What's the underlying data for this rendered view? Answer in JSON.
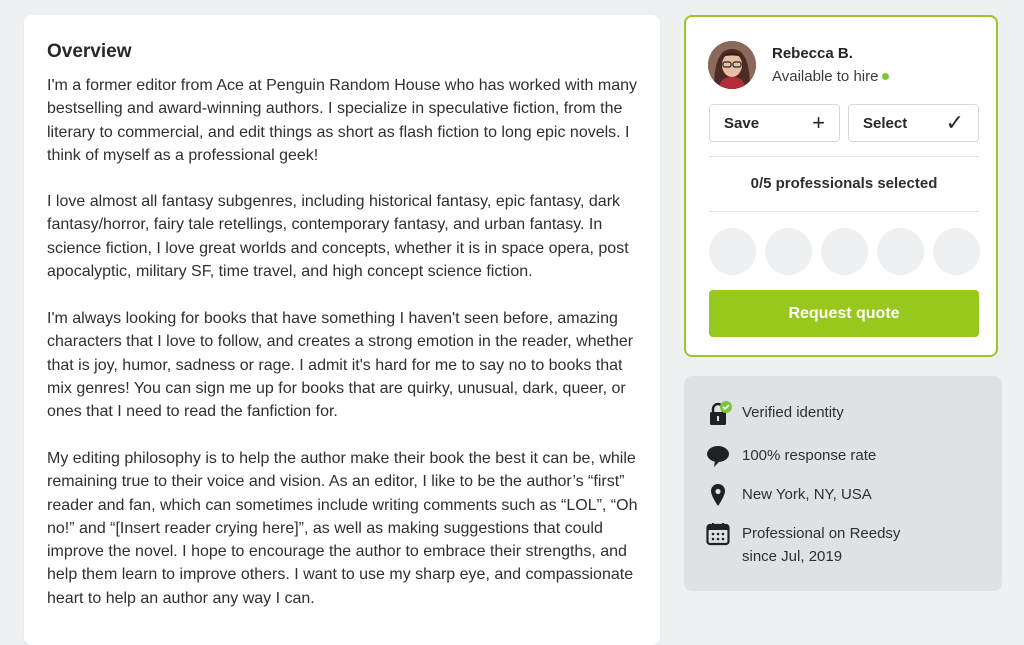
{
  "overview": {
    "title": "Overview",
    "paragraphs": [
      "I'm a former editor from Ace at Penguin Random House who has worked with many bestselling and award-winning authors. I specialize in speculative fiction, from the literary to commercial, and edit things as short as flash fiction to long epic novels. I think of myself as a professional geek!",
      "I love almost all fantasy subgenres, including historical fantasy, epic fantasy, dark fantasy/horror, fairy tale retellings, contemporary fantasy, and urban fantasy. In science fiction, I love great worlds and concepts, whether it is in space opera, post apocalyptic, military SF, time travel, and high concept science fiction.",
      "I'm always looking for books that have something I haven't seen before, amazing characters that I love to follow, and creates a strong emotion in the reader, whether that is joy, humor, sadness or rage. I admit it's hard for me to say no to books that mix genres! You can sign me up for books that are quirky, unusual, dark, queer, or ones that I need to read the fanfiction for.",
      "My editing philosophy is to help the author make their book the best it can be, while remaining true to their voice and vision. As an editor, I like to be the author’s “first” reader and fan, which can sometimes include writing comments such as “LOL”, “Oh no!” and “[Insert reader crying here]”, as well as making suggestions that could improve the novel. I hope to encourage the author to embrace their strengths, and help them learn to improve others. I want to use my sharp eye, and compassionate heart to help an author any way I can."
    ]
  },
  "professional": {
    "name": "Rebecca B.",
    "status": "Available to hire",
    "save_label": "Save",
    "save_icon": "+",
    "select_label": "Select",
    "select_icon": "✓",
    "selected_count": "0/5 professionals selected",
    "request_label": "Request quote"
  },
  "info": {
    "verified": "Verified identity",
    "response_rate": "100% response rate",
    "location": "New York, NY, USA",
    "member_line1": "Professional on Reedsy",
    "member_line2": "since Jul, 2019"
  },
  "colors": {
    "accent": "#97c81b",
    "card_border": "#98c72a",
    "status_dot": "#7dc43a"
  }
}
